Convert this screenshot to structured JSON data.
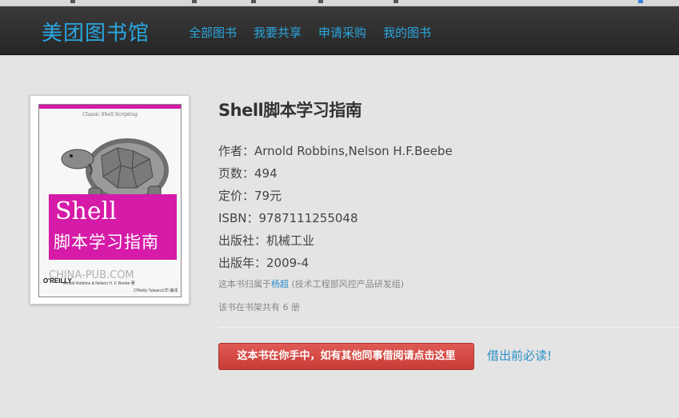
{
  "header": {
    "brand": "美团图书馆",
    "nav": [
      {
        "label": "全部图书"
      },
      {
        "label": "我要共享"
      },
      {
        "label": "申请采购"
      },
      {
        "label": "我的图书"
      }
    ]
  },
  "book": {
    "cover": {
      "series": "Classic Shell Scripting",
      "title_en": "Shell",
      "title_cn": "脚本学习指南",
      "watermark": "CHINA-PUB.COM",
      "publisher_logo": "O'REILLY",
      "authors_line": "Arnold Robbins & Nelson H. F. Beebe 著",
      "translator_line": "O'Reilly Taiwan公司 编译"
    },
    "title": "Shell脚本学习指南",
    "author": "作者：Arnold Robbins,Nelson H.F.Beebe",
    "pages": "页数：494",
    "price": "定价：79元",
    "isbn": "ISBN：9787111255048",
    "publisher": "出版社：机械工业",
    "year": "出版年：2009-4",
    "owner_prefix": "这本书归属于",
    "owner_name": "杨超",
    "owner_dept": "(技术工程部风控产品研发组)",
    "shelf_count": "该书在书架共有 6 册"
  },
  "actions": {
    "borrow_label": "这本书在你手中，如有其他同事借阅请点击这里",
    "must_read_label": "借出前必读!"
  },
  "colors": {
    "accent": "#2aa7e0",
    "navbar": "#2b2b2b",
    "danger": "#d44a45",
    "cover_magenta": "#d51ba8"
  }
}
